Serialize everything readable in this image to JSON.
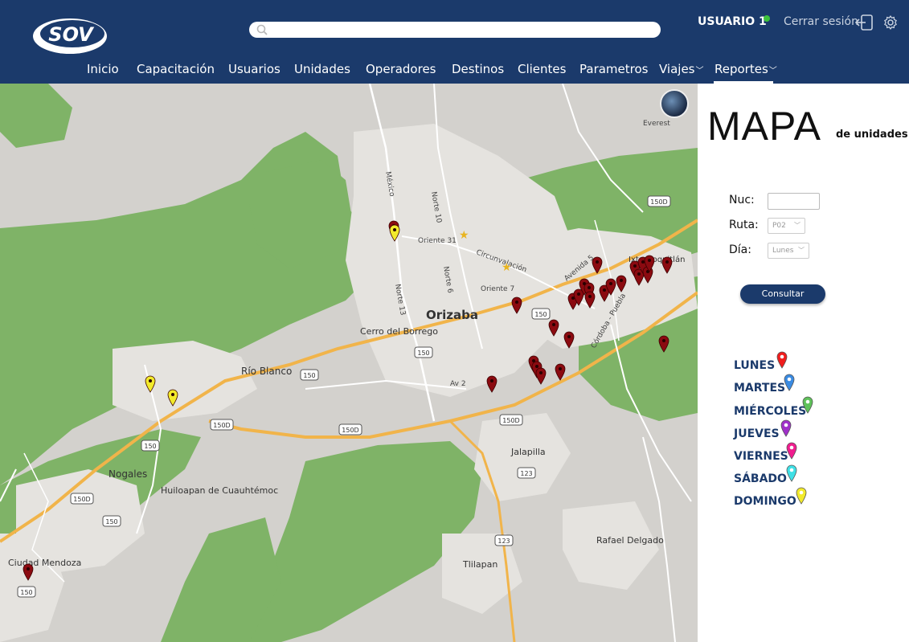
{
  "header": {
    "logo_text": "SOV",
    "search": {
      "placeholder": ""
    },
    "user_name": "USUARIO 1",
    "logout_label": "Cerrar sesión"
  },
  "nav": [
    {
      "label": "Inicio"
    },
    {
      "label": "Capacitación"
    },
    {
      "label": "Usuarios"
    },
    {
      "label": "Unidades"
    },
    {
      "label": "Operadores"
    },
    {
      "label": "Destinos"
    },
    {
      "label": "Clientes"
    },
    {
      "label": "Parametros"
    },
    {
      "label": "Viajes",
      "dropdown": true
    },
    {
      "label": "Reportes",
      "dropdown": true,
      "active": true
    }
  ],
  "map": {
    "labels": [
      "Orizaba",
      "Cerro del Borrego",
      "Río Blanco",
      "Nogales",
      "Huiloapan de Cuauhtémoc",
      "Ciudad Mendoza",
      "Jalapilla",
      "Tlilapan",
      "Rafael Delgado",
      "Ixtaczoquitlán",
      "Oriente 31",
      "Oriente 7",
      "Circunvalación",
      "Norte 10",
      "Norte 6",
      "Norte 13",
      "México",
      "Av 2",
      "Córdoba - Puebla",
      "Avenida 5",
      "Everest",
      "150D",
      "150",
      "123"
    ],
    "colors": {
      "land": "#d3d1cd",
      "green": "#7fb367",
      "urban": "#e5e3df",
      "highway": "#f1b44a",
      "road": "#ffffff",
      "pin_red": "#8b0a10",
      "pin_yellow": "#f2ea2b"
    }
  },
  "panel": {
    "title": "MAPA",
    "subtitle": "de unidades",
    "nuc_label": "Nuc:",
    "nuc_value": "",
    "ruta_label": "Ruta:",
    "ruta_value": "P02",
    "dia_label": "Día:",
    "dia_value": "Lunes",
    "consult_label": "Consultar"
  },
  "legend": [
    {
      "label": "LUNES",
      "color": "#f01d1d"
    },
    {
      "label": "MARTES",
      "color": "#3a8be2"
    },
    {
      "label": "MIÉRCOLES",
      "color": "#5fc15a"
    },
    {
      "label": "JUEVES",
      "color": "#a030c9"
    },
    {
      "label": "VIERNES",
      "color": "#f01d8f"
    },
    {
      "label": "SÁBADO",
      "color": "#3fe0e6"
    },
    {
      "label": "DOMINGO",
      "color": "#f2ea2b"
    }
  ]
}
